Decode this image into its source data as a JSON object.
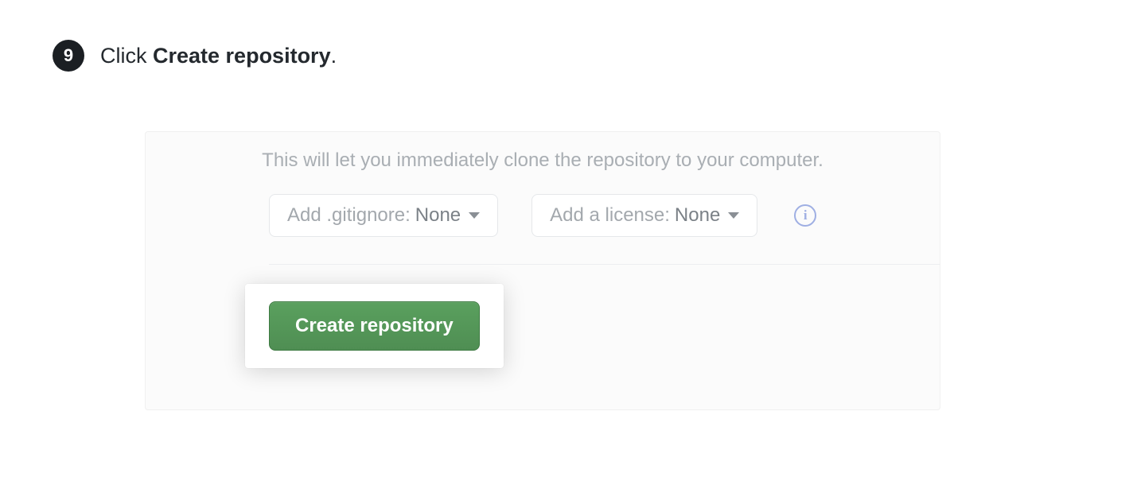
{
  "step": {
    "number": "9",
    "prefix": "Click ",
    "bold": "Create repository",
    "suffix": "."
  },
  "panel": {
    "hint": "This will let you immediately clone the repository to your computer.",
    "gitignore": {
      "label": "Add .gitignore: ",
      "value": "None"
    },
    "license": {
      "label": "Add a license: ",
      "value": "None"
    },
    "info_glyph": "i",
    "create_label": "Create repository"
  }
}
